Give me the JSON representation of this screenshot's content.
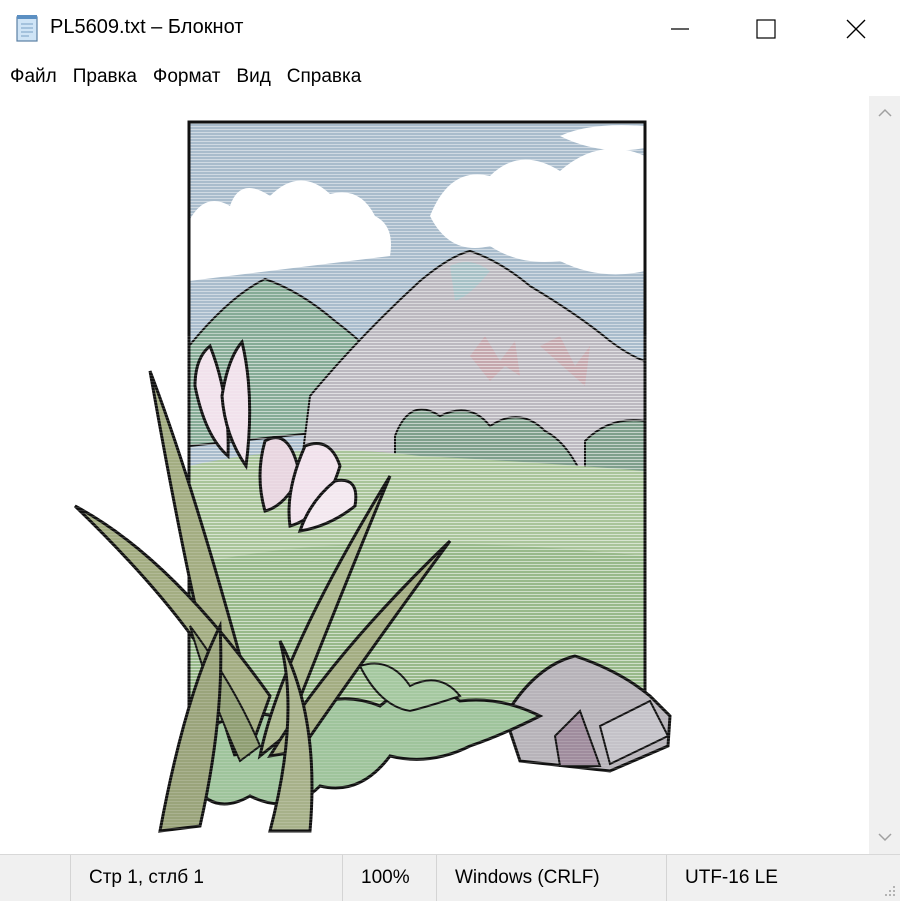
{
  "window": {
    "title": "PL5609.txt – Блокнот",
    "icon": "notepad-icon",
    "controls": [
      "minimize-icon",
      "maximize-icon",
      "close-icon"
    ]
  },
  "menu": {
    "items": [
      {
        "label": "Файл"
      },
      {
        "label": "Правка"
      },
      {
        "label": "Формат"
      },
      {
        "label": "Вид"
      },
      {
        "label": "Справка"
      }
    ]
  },
  "editor": {
    "content_icon": "ascii-art-landscape-with-crocus-flowers"
  },
  "statusbar": {
    "position": "Стр 1, стлб 1",
    "zoom": "100%",
    "line_endings": "Windows (CRLF)",
    "encoding": "UTF-16 LE"
  },
  "colors": {
    "sky": "#a9bccc",
    "cloud": "#ffffff",
    "mountain_green": "#86ab96",
    "mountain_gray": "#bcb9c0",
    "meadow": "#a9c49a",
    "leaf": "#a3ad82",
    "petal": "#f1e2ec",
    "rock": "#b7b3b9",
    "outline": "#111111"
  }
}
